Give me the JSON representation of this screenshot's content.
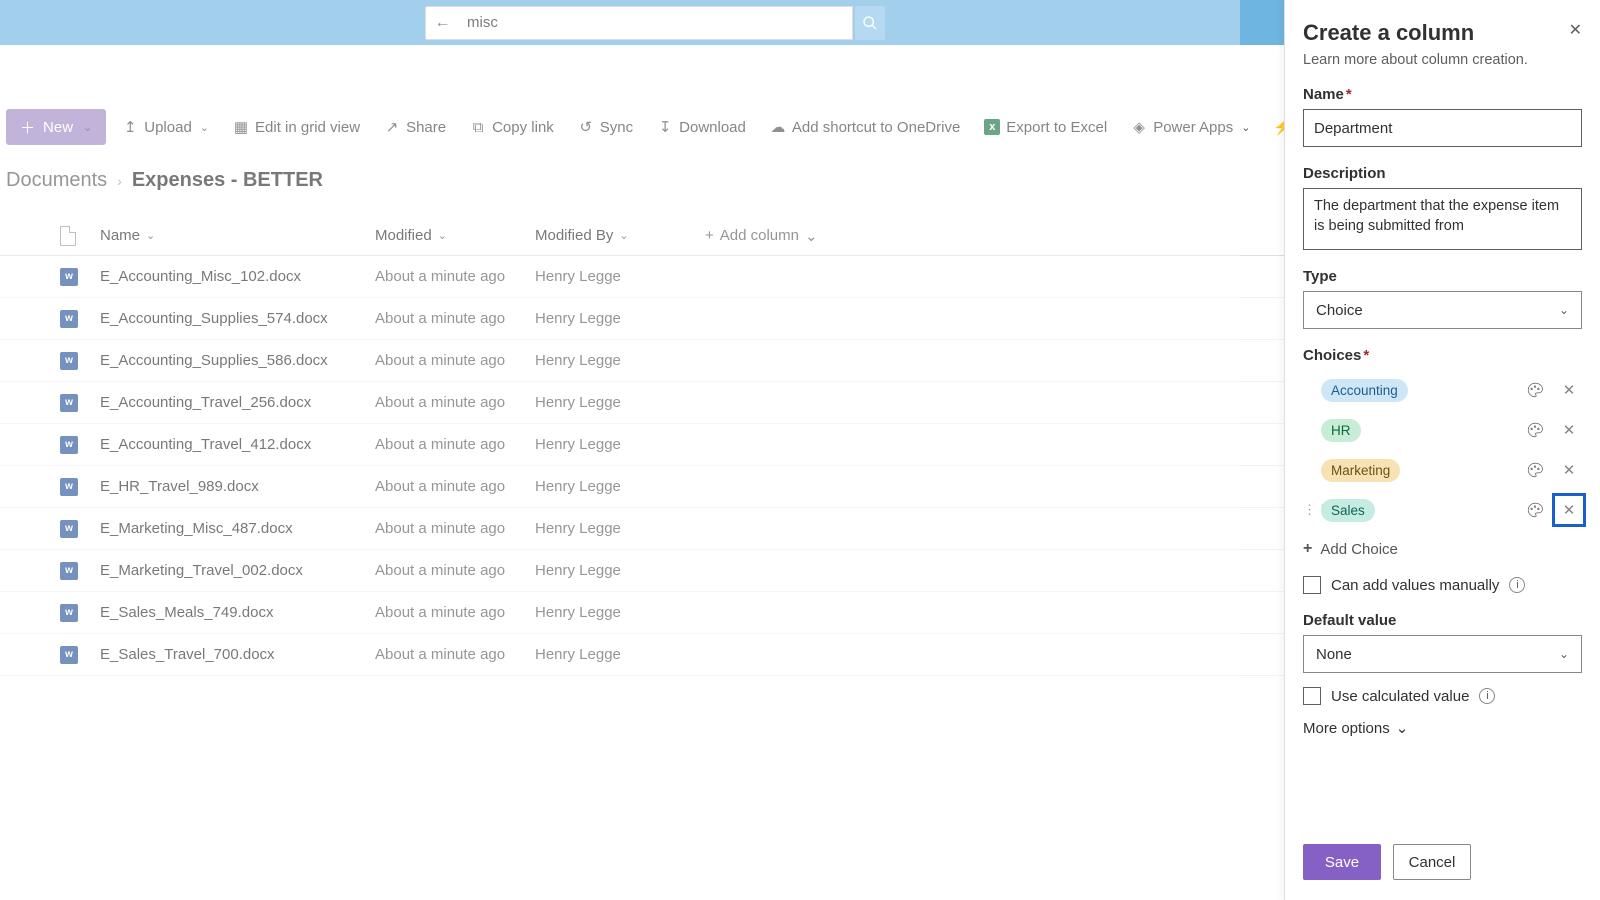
{
  "search": {
    "value": "misc"
  },
  "toolbar": {
    "new": "New",
    "upload": "Upload",
    "edit_grid": "Edit in grid view",
    "share": "Share",
    "copy_link": "Copy link",
    "sync": "Sync",
    "download": "Download",
    "add_shortcut": "Add shortcut to OneDrive",
    "export_excel": "Export to Excel",
    "power_apps": "Power Apps",
    "automate": "Automate"
  },
  "breadcrumb": {
    "root": "Documents",
    "current": "Expenses - BETTER"
  },
  "columns": {
    "name": "Name",
    "modified": "Modified",
    "modified_by": "Modified By",
    "add_column": "Add column"
  },
  "rows": [
    {
      "name": "E_Accounting_Misc_102.docx",
      "modified": "About a minute ago",
      "by": "Henry Legge"
    },
    {
      "name": "E_Accounting_Supplies_574.docx",
      "modified": "About a minute ago",
      "by": "Henry Legge"
    },
    {
      "name": "E_Accounting_Supplies_586.docx",
      "modified": "About a minute ago",
      "by": "Henry Legge"
    },
    {
      "name": "E_Accounting_Travel_256.docx",
      "modified": "About a minute ago",
      "by": "Henry Legge"
    },
    {
      "name": "E_Accounting_Travel_412.docx",
      "modified": "About a minute ago",
      "by": "Henry Legge"
    },
    {
      "name": "E_HR_Travel_989.docx",
      "modified": "About a minute ago",
      "by": "Henry Legge"
    },
    {
      "name": "E_Marketing_Misc_487.docx",
      "modified": "About a minute ago",
      "by": "Henry Legge"
    },
    {
      "name": "E_Marketing_Travel_002.docx",
      "modified": "About a minute ago",
      "by": "Henry Legge"
    },
    {
      "name": "E_Sales_Meals_749.docx",
      "modified": "About a minute ago",
      "by": "Henry Legge"
    },
    {
      "name": "E_Sales_Travel_700.docx",
      "modified": "About a minute ago",
      "by": "Henry Legge"
    }
  ],
  "panel": {
    "title": "Create a column",
    "learn": "Learn more about column creation.",
    "name_label": "Name",
    "name_value": "Department",
    "desc_label": "Description",
    "desc_value": "The department that the expense item is being submitted from",
    "type_label": "Type",
    "type_value": "Choice",
    "choices_label": "Choices",
    "choices": [
      {
        "label": "Accounting",
        "chip": "chip-blue",
        "active": false
      },
      {
        "label": "HR",
        "chip": "chip-green",
        "active": false
      },
      {
        "label": "Marketing",
        "chip": "chip-yellow",
        "active": false
      },
      {
        "label": "Sales",
        "chip": "chip-teal",
        "active": true
      }
    ],
    "add_choice": "Add Choice",
    "can_add_manually": "Can add values manually",
    "default_label": "Default value",
    "default_value": "None",
    "use_calc": "Use calculated value",
    "more_options": "More options",
    "save": "Save",
    "cancel": "Cancel"
  }
}
